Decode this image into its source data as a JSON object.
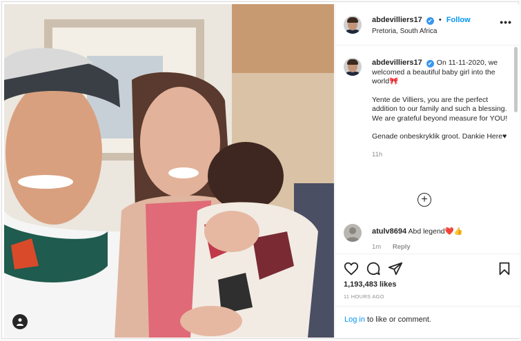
{
  "post": {
    "username": "abdevilliers17",
    "verified_mark": "✔",
    "dot": "•",
    "follow_label": "Follow",
    "location": "Pretoria, South Africa",
    "more_icon": "•••"
  },
  "caption": {
    "username": "abdevilliers17",
    "line1": "On 11-11-2020, we welcomed a beautiful baby girl into the world🎀",
    "line2": "Yente de Villiers, you are the perfect addition to our family and such a blessing. We are grateful beyond measure for YOU!",
    "line3": "Genade onbeskryklik groot. Dankie Here♥",
    "time": "11h"
  },
  "load_more_icon": "+",
  "comment": {
    "username": "atulv8694",
    "text": "Abd legend❤️👍",
    "time": "1m",
    "reply_label": "Reply"
  },
  "stats": {
    "likes": "1,193,483 likes",
    "ago": "11 HOURS AGO"
  },
  "login": {
    "link": "Log in",
    "rest": " to like or comment."
  },
  "icons": [
    "heart-icon",
    "comment-icon",
    "share-icon",
    "bookmark-icon",
    "user-tag-icon",
    "add-circle-icon",
    "more-options-icon"
  ],
  "colors": {
    "accent": "#0095f6",
    "verified": "#3897f0",
    "text": "#262626",
    "muted": "#8e8e8e",
    "border": "#efefef"
  }
}
